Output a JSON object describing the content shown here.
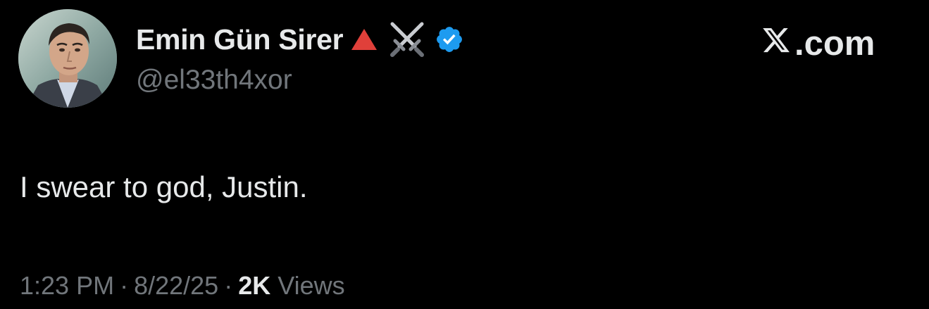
{
  "tweet": {
    "author": {
      "display_name": "Emin Gün Sirer",
      "handle": "@el33th4xor",
      "emoji_icons": [
        "red-triangle-icon",
        "crossed-swords-icon"
      ],
      "verified": true
    },
    "site_label": ".com",
    "text": "I swear to god, Justin.",
    "time": "1:23 PM",
    "date": "8/22/25",
    "views_count": "2K",
    "views_label": "Views",
    "separator": "·"
  },
  "colors": {
    "background": "#000000",
    "primary_text": "#e7e9ea",
    "secondary_text": "#71767b",
    "verified_badge": "#1d9bf0",
    "red_triangle": "#e0403a"
  }
}
